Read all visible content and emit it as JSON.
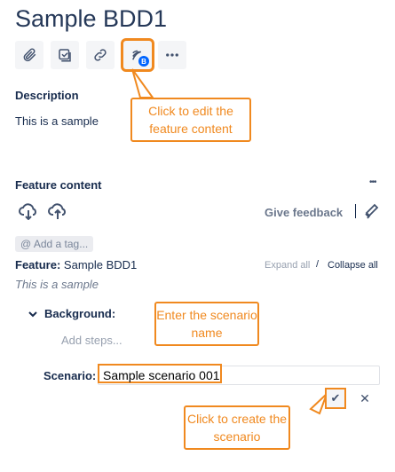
{
  "issue": {
    "title": "Sample BDD1"
  },
  "toolbar": {
    "icons": [
      "attachment-icon",
      "checklist-icon",
      "link-icon",
      "feature-edit-icon",
      "more-icon"
    ],
    "badge": "B"
  },
  "description": {
    "label": "Description",
    "text": "This is a sample"
  },
  "callouts": {
    "edit_feature": "Click to edit the feature content",
    "enter_name": "Enter the scenario name",
    "create": "Click to create the scenario"
  },
  "feature_panel": {
    "label": "Feature content",
    "more": "•••",
    "give_feedback": "Give feedback",
    "tag_placeholder": "@ Add a tag...",
    "feature_keyword": "Feature:",
    "feature_name": "Sample BDD1",
    "feature_desc": "This is a sample",
    "expand_all": "Expand all",
    "separator": "/",
    "collapse_all": "Collapse all",
    "background_keyword": "Background:",
    "add_steps": "Add steps...",
    "scenario_keyword": "Scenario:",
    "scenario_value": "Sample scenario 001",
    "confirm": "✔",
    "cancel": "✕"
  },
  "colors": {
    "highlight": "#f0891f",
    "badge": "#0065ff"
  }
}
